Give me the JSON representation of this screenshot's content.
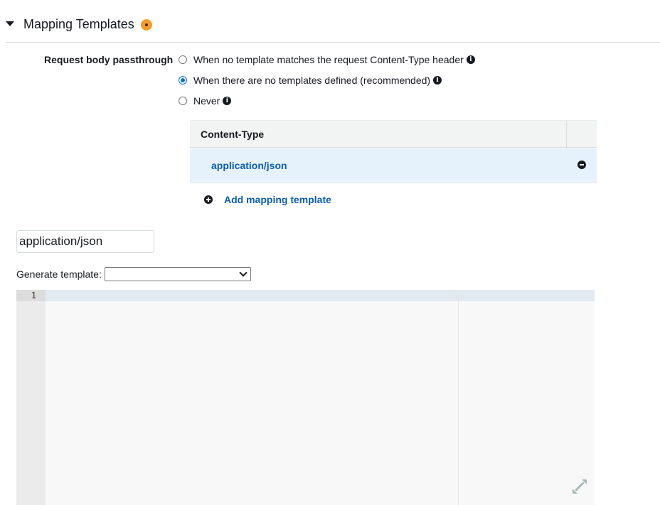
{
  "section": {
    "title": "Mapping Templates"
  },
  "passthrough": {
    "label": "Request body passthrough",
    "options": [
      {
        "label": "When no template matches the request Content-Type header",
        "checked": false
      },
      {
        "label": "When there are no templates defined (recommended)",
        "checked": true
      },
      {
        "label": "Never",
        "checked": false
      }
    ]
  },
  "content_types": {
    "header": "Content-Type",
    "rows": [
      "application/json"
    ],
    "add_label": "Add mapping template"
  },
  "template_editor": {
    "content_type_value": "application/json",
    "generate_label": "Generate template:",
    "generate_selected": "",
    "line_numbers": [
      "1"
    ]
  },
  "icons": {
    "collapse": "caret-down-icon",
    "info": "info-icon",
    "remove": "minus-circle-icon",
    "add": "plus-circle-icon",
    "expand": "expand-icon"
  },
  "colors": {
    "link": "#0a5db3",
    "selected_row": "#e6f2fb",
    "radio_checked": "#0972d3",
    "status_dot": "#f59c2a"
  }
}
